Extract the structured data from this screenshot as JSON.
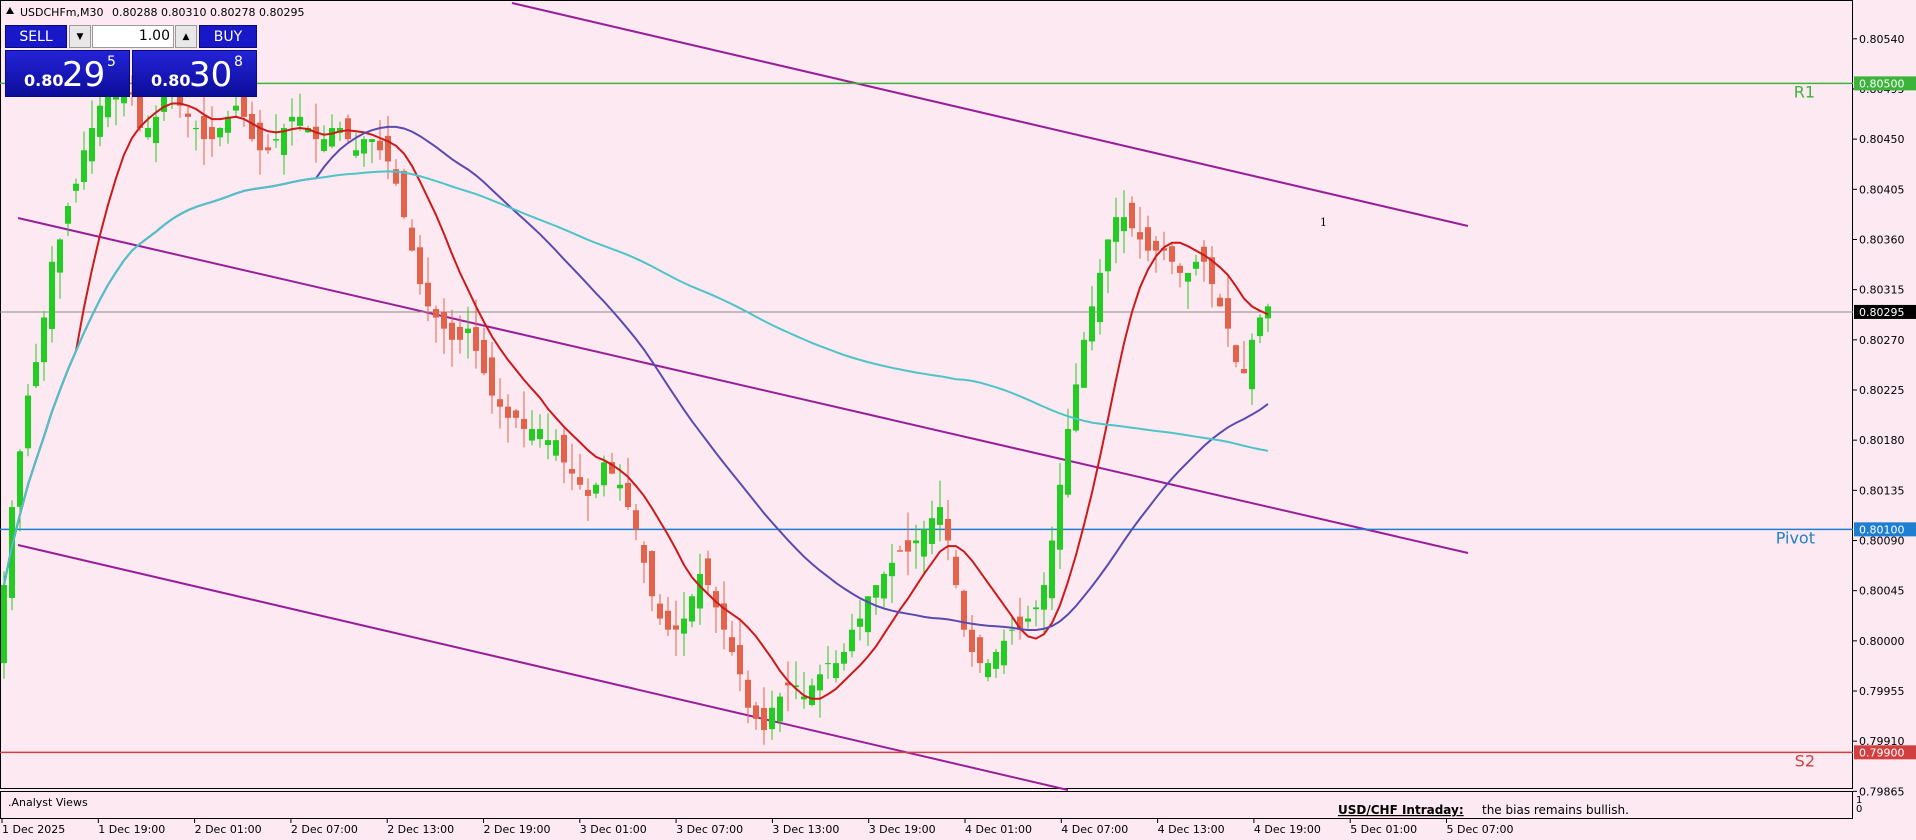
{
  "header": {
    "symbol_info": "USDCHFm,M30",
    "ohlc": "0.80288 0.80310 0.80278 0.80295"
  },
  "trade_panel": {
    "sell_label": "SELL",
    "buy_label": "BUY",
    "lot_value": "1.00",
    "sell_prefix": "0.80",
    "sell_big": "29",
    "sell_sup": "5",
    "buy_prefix": "0.80",
    "buy_big": "30",
    "buy_sup": "8",
    "down_arrow": "▼",
    "up_arrow": "▲"
  },
  "indicator_panel": {
    "label": ".Analyst Views",
    "scale_top": "1",
    "scale_bottom": "0",
    "note_title": "USD/CHF Intraday:",
    "note_text": "the bias remains bullish."
  },
  "chart_data": {
    "type": "candlestick",
    "symbol": "USDCHFm",
    "timeframe": "M30",
    "ylim": [
      0.79868,
      0.80573
    ],
    "y_ticks": [
      "0.80540",
      "0.80495",
      "0.80450",
      "0.80405",
      "0.80360",
      "0.80315",
      "0.80270",
      "0.80225",
      "0.80180",
      "0.80135",
      "0.80090",
      "0.80045",
      "0.80000",
      "0.79955",
      "0.79910",
      "0.79865"
    ],
    "x_tick_labels": [
      "1 Dec 2025",
      "1 Dec 19:00",
      "2 Dec 01:00",
      "2 Dec 07:00",
      "2 Dec 13:00",
      "2 Dec 19:00",
      "3 Dec 01:00",
      "3 Dec 07:00",
      "3 Dec 13:00",
      "3 Dec 19:00",
      "4 Dec 01:00",
      "4 Dec 07:00",
      "4 Dec 13:00",
      "4 Dec 19:00",
      "5 Dec 01:00",
      "5 Dec 07:00"
    ],
    "current_price": "0.80295",
    "levels": [
      {
        "name": "R1",
        "value": 0.805,
        "label": "0.80500",
        "color": "#3cb43c"
      },
      {
        "name": "Pivot",
        "value": 0.801,
        "label": "0.80100",
        "color": "#1e7ed0"
      },
      {
        "name": "S2",
        "value": 0.799,
        "label": "0.79900",
        "color": "#d04040"
      }
    ],
    "bull_color": "#22cc22",
    "bear_color": "#e2634a",
    "closes": [
      0.8005,
      0.8012,
      0.8017,
      0.8022,
      0.8025,
      0.8029,
      0.8034,
      0.8036,
      0.8039,
      0.8041,
      0.8044,
      0.8046,
      0.8048,
      0.8049,
      0.8049,
      0.805,
      0.8049,
      0.8046,
      0.8046,
      0.8047,
      0.8049,
      0.8049,
      0.8048,
      0.8047,
      0.8046,
      0.8045,
      0.8045,
      0.8046,
      0.8047,
      0.8048,
      0.8047,
      0.8045,
      0.8044,
      0.8044,
      0.8045,
      0.8046,
      0.8047,
      0.8047,
      0.8046,
      0.8045,
      0.8045,
      0.8046,
      0.8046,
      0.8045,
      0.8044,
      0.8045,
      0.8045,
      0.8044,
      0.8043,
      0.8041,
      0.8038,
      0.8035,
      0.8032,
      0.803,
      0.8029,
      0.8028,
      0.8027,
      0.8027,
      0.8028,
      0.8026,
      0.8024,
      0.8022,
      0.8021,
      0.802,
      0.802,
      0.8019,
      0.8019,
      0.8019,
      0.8018,
      0.8018,
      0.8016,
      0.8015,
      0.8014,
      0.8013,
      0.8014,
      0.8016,
      0.8015,
      0.8014,
      0.8012,
      0.801,
      0.8007,
      0.8004,
      0.8002,
      0.8001,
      0.8001,
      0.8002,
      0.8004,
      0.8006,
      0.8005,
      0.8003,
      0.8001,
      0.7999,
      0.7997,
      0.7994,
      0.7993,
      0.7992,
      0.7994,
      0.7995,
      0.7996,
      0.7996,
      0.7995,
      0.7996,
      0.7997,
      0.7998,
      0.7998,
      0.7999,
      0.8001,
      0.8002,
      0.8004,
      0.8005,
      0.8006,
      0.8007,
      0.8008,
      0.8008,
      0.8009,
      0.801,
      0.8011,
      0.8012,
      0.8009,
      0.8005,
      0.8001,
      0.7999,
      0.7998,
      0.7998,
      0.7999,
      0.8,
      0.8001,
      0.8001,
      0.8002,
      0.8003,
      0.8005,
      0.8009,
      0.8014,
      0.8019,
      0.8023,
      0.8027,
      0.803,
      0.8033,
      0.8036,
      0.8038,
      0.8038,
      0.8037,
      0.8036,
      0.8035,
      0.8035,
      0.8035,
      0.8034,
      0.8033,
      0.8033,
      0.8034,
      0.8034,
      0.8032,
      0.803,
      0.8028,
      0.8025,
      0.8024,
      0.8027,
      0.8029,
      0.803
    ]
  }
}
